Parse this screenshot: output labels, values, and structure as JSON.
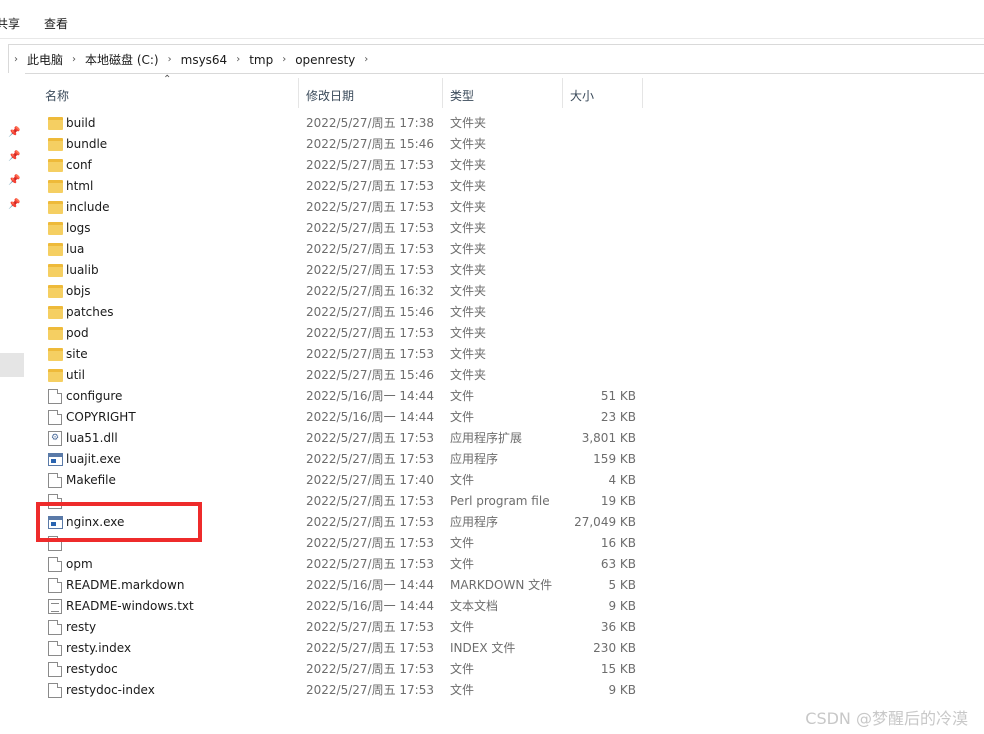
{
  "ribbon": {
    "cutoff_tab": "共享",
    "view_tab": "查看"
  },
  "breadcrumb": [
    "此电脑",
    "本地磁盘 (C:)",
    "msys64",
    "tmp",
    "openresty"
  ],
  "columns": {
    "name": "名称",
    "date": "修改日期",
    "type": "类型",
    "size": "大小"
  },
  "files": [
    {
      "name": "build",
      "date": "2022/5/27/周五 17:38",
      "type": "文件夹",
      "size": "",
      "icon": "folder-icon"
    },
    {
      "name": "bundle",
      "date": "2022/5/27/周五 15:46",
      "type": "文件夹",
      "size": "",
      "icon": "folder-icon"
    },
    {
      "name": "conf",
      "date": "2022/5/27/周五 17:53",
      "type": "文件夹",
      "size": "",
      "icon": "folder-icon"
    },
    {
      "name": "html",
      "date": "2022/5/27/周五 17:53",
      "type": "文件夹",
      "size": "",
      "icon": "folder-icon"
    },
    {
      "name": "include",
      "date": "2022/5/27/周五 17:53",
      "type": "文件夹",
      "size": "",
      "icon": "folder-icon"
    },
    {
      "name": "logs",
      "date": "2022/5/27/周五 17:53",
      "type": "文件夹",
      "size": "",
      "icon": "folder-icon"
    },
    {
      "name": "lua",
      "date": "2022/5/27/周五 17:53",
      "type": "文件夹",
      "size": "",
      "icon": "folder-icon"
    },
    {
      "name": "lualib",
      "date": "2022/5/27/周五 17:53",
      "type": "文件夹",
      "size": "",
      "icon": "folder-icon"
    },
    {
      "name": "objs",
      "date": "2022/5/27/周五 16:32",
      "type": "文件夹",
      "size": "",
      "icon": "folder-icon"
    },
    {
      "name": "patches",
      "date": "2022/5/27/周五 15:46",
      "type": "文件夹",
      "size": "",
      "icon": "folder-icon"
    },
    {
      "name": "pod",
      "date": "2022/5/27/周五 17:53",
      "type": "文件夹",
      "size": "",
      "icon": "folder-icon"
    },
    {
      "name": "site",
      "date": "2022/5/27/周五 17:53",
      "type": "文件夹",
      "size": "",
      "icon": "folder-icon"
    },
    {
      "name": "util",
      "date": "2022/5/27/周五 15:46",
      "type": "文件夹",
      "size": "",
      "icon": "folder-icon"
    },
    {
      "name": "configure",
      "date": "2022/5/16/周一 14:44",
      "type": "文件",
      "size": "51 KB",
      "icon": "file-icon"
    },
    {
      "name": "COPYRIGHT",
      "date": "2022/5/16/周一 14:44",
      "type": "文件",
      "size": "23 KB",
      "icon": "file-icon"
    },
    {
      "name": "lua51.dll",
      "date": "2022/5/27/周五 17:53",
      "type": "应用程序扩展",
      "size": "3,801 KB",
      "icon": "dll-icon"
    },
    {
      "name": "luajit.exe",
      "date": "2022/5/27/周五 17:53",
      "type": "应用程序",
      "size": "159 KB",
      "icon": "exe-icon"
    },
    {
      "name": "Makefile",
      "date": "2022/5/27/周五 17:40",
      "type": "文件",
      "size": "4 KB",
      "icon": "file-icon"
    },
    {
      "name": "",
      "date": "2022/5/27/周五 17:53",
      "type": "Perl program file",
      "size": "19 KB",
      "icon": "file-icon"
    },
    {
      "name": "nginx.exe",
      "date": "2022/5/27/周五 17:53",
      "type": "应用程序",
      "size": "27,049 KB",
      "icon": "exe-icon"
    },
    {
      "name": "",
      "date": "2022/5/27/周五 17:53",
      "type": "文件",
      "size": "16 KB",
      "icon": "file-icon"
    },
    {
      "name": "opm",
      "date": "2022/5/27/周五 17:53",
      "type": "文件",
      "size": "63 KB",
      "icon": "file-icon"
    },
    {
      "name": "README.markdown",
      "date": "2022/5/16/周一 14:44",
      "type": "MARKDOWN 文件",
      "size": "5 KB",
      "icon": "file-icon"
    },
    {
      "name": "README-windows.txt",
      "date": "2022/5/16/周一 14:44",
      "type": "文本文档",
      "size": "9 KB",
      "icon": "text-file-icon"
    },
    {
      "name": "resty",
      "date": "2022/5/27/周五 17:53",
      "type": "文件",
      "size": "36 KB",
      "icon": "file-icon"
    },
    {
      "name": "resty.index",
      "date": "2022/5/27/周五 17:53",
      "type": "INDEX 文件",
      "size": "230 KB",
      "icon": "file-icon"
    },
    {
      "name": "restydoc",
      "date": "2022/5/27/周五 17:53",
      "type": "文件",
      "size": "15 KB",
      "icon": "file-icon"
    },
    {
      "name": "restydoc-index",
      "date": "2022/5/27/周五 17:53",
      "type": "文件",
      "size": "9 KB",
      "icon": "file-icon"
    }
  ],
  "watermark": "CSDN @梦醒后的冷漠",
  "colors": {
    "highlight": "#ee2b2b",
    "folder": "#f5cf62"
  }
}
